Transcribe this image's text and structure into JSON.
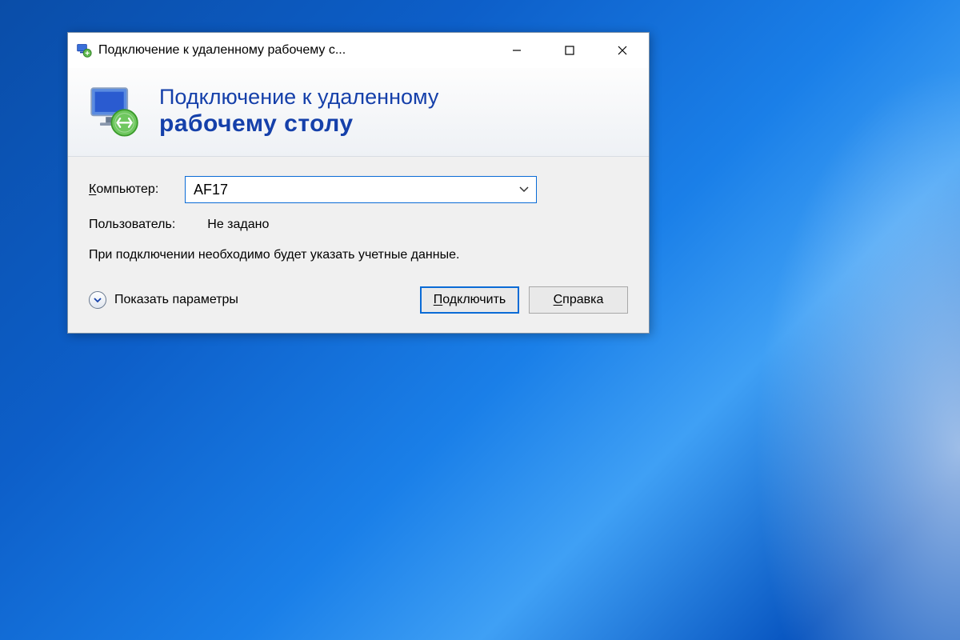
{
  "window": {
    "title": "Подключение к удаленному рабочему с...",
    "banner_line1": "Подключение к удаленному",
    "banner_line2": "рабочему столу"
  },
  "form": {
    "computer_label_pre": "К",
    "computer_label_rest": "омпьютер:",
    "computer_value": "AF17",
    "user_label": "Пользователь:",
    "user_value": "Не задано",
    "info_text": "При подключении необходимо будет указать учетные данные."
  },
  "footer": {
    "show_options": "Показать параметры",
    "connect_pre": "П",
    "connect_rest": "одключить",
    "help_pre": "С",
    "help_rest": "правка"
  }
}
